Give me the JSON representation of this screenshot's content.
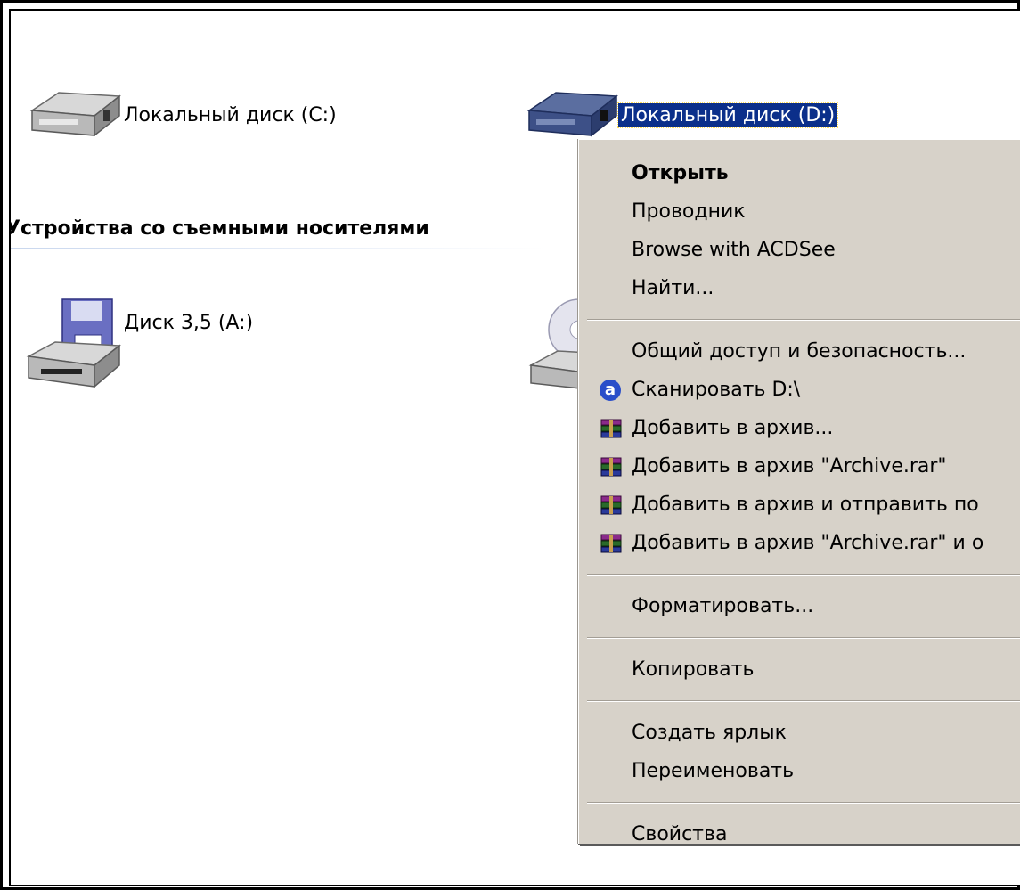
{
  "drives": {
    "c": {
      "label": "Локальный диск (C:)",
      "icon": "hard-drive-icon"
    },
    "d": {
      "label": "Локальный диск (D:)",
      "icon": "hard-drive-selected-icon"
    }
  },
  "removable": {
    "section_title": "Устройства со съемными носителями",
    "floppy": {
      "label": "Диск 3,5 (A:)",
      "icon": "floppy-drive-icon"
    },
    "cd": {
      "label": "",
      "icon": "cd-drive-icon"
    }
  },
  "context_menu": {
    "items": {
      "open": "Открыть",
      "explorer": "Проводник",
      "acdsee": "Browse with ACDSee",
      "find": "Найти...",
      "sharing": "Общий доступ и безопасность...",
      "scan": "Сканировать D:\\",
      "add_archive": "Добавить в архив...",
      "add_archive_rar": "Добавить в архив \"Archive.rar\"",
      "add_archive_send": "Добавить в архив и отправить по",
      "add_archive_rar_send": "Добавить в архив \"Archive.rar\" и о",
      "format": "Форматировать...",
      "copy": "Копировать",
      "shortcut": "Создать ярлык",
      "rename": "Переименовать",
      "properties": "Свойства"
    },
    "icons": {
      "scan": "avast-icon",
      "archive": "winrar-icon"
    },
    "avast_letter": "a"
  },
  "colors": {
    "selection_bg": "#0b2f8a",
    "menu_bg": "#d7d2c9",
    "avast_blue": "#2a4ec9"
  }
}
